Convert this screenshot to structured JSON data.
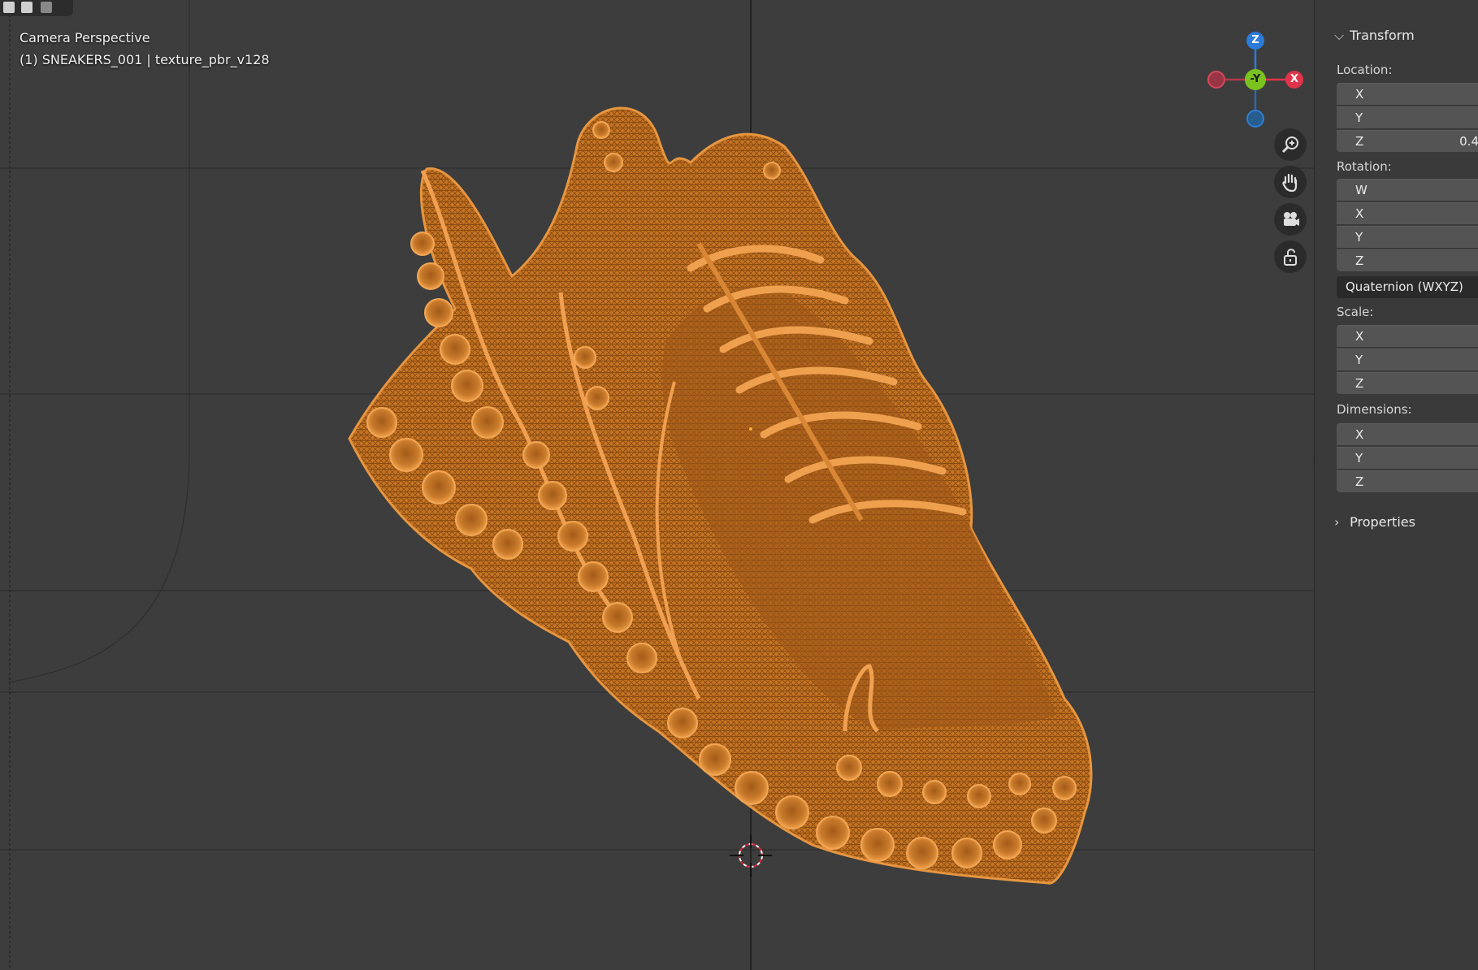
{
  "viewport": {
    "view_name": "Camera Perspective",
    "object_info": "(1) SNEAKERS_001 | texture_pbr_v128",
    "model": {
      "shading": "wireframe",
      "color": "#d8822e"
    },
    "colors": {
      "background": "#3d3d3d",
      "grid": "#2f2f2f",
      "x_axis": "#e0344b",
      "y_axis": "#7bc21e",
      "z_axis": "#2d7bd8"
    }
  },
  "gizmo": {
    "z_label": "Z",
    "y_label": "-Y",
    "x_label": "X",
    "nav_icons": [
      "zoom-icon",
      "hand-pan-icon",
      "camera-icon",
      "lock-icon"
    ]
  },
  "sidebar": {
    "transform": {
      "header": "Transform",
      "location": {
        "label": "Location:",
        "x": "X",
        "y": "Y",
        "z": "Z",
        "z_value": "0.4"
      },
      "rotation": {
        "label": "Rotation:",
        "w": "W",
        "x": "X",
        "y": "Y",
        "z": "Z",
        "mode": "Quaternion (WXYZ)"
      },
      "scale": {
        "label": "Scale:",
        "x": "X",
        "y": "Y",
        "z": "Z"
      },
      "dimensions": {
        "label": "Dimensions:",
        "x": "X",
        "y": "Y",
        "z": "Z"
      }
    },
    "properties": {
      "header": "Properties"
    }
  }
}
